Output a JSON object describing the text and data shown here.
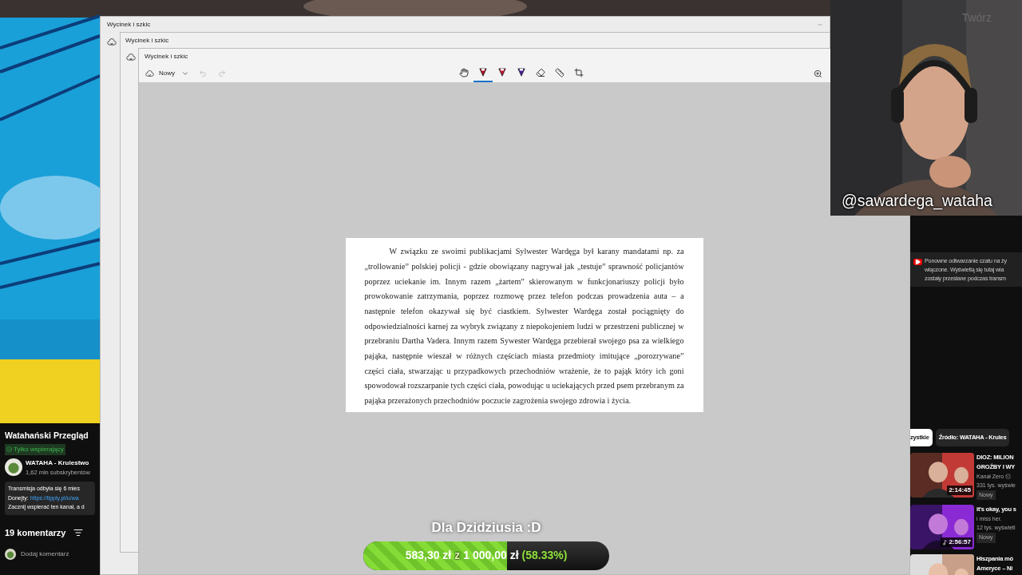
{
  "left_panel": {
    "title": "Watahański Przegląd",
    "badge": "Tylko wspierający",
    "channel": {
      "name": "WATAHA - Krulestwo",
      "subscribers": "1,62 mln subskrybentów"
    },
    "description": {
      "first_line": "Transmisja odbyła się 6 mies",
      "donations_label": "Donejty:",
      "donations_link": "https://tipply.pl/u/wa",
      "last_line": "Zacznij wspierać ten kanał, a d"
    },
    "comments": {
      "count": "19 komentarzy",
      "placeholder": "Dodaj komentarz"
    }
  },
  "windows": [
    {
      "title": "Wycinek i szkic"
    },
    {
      "title": "Wycinek i szkic"
    }
  ],
  "editor": {
    "title": "Wycinek i szkic",
    "new_label": "Nowy",
    "tools": [
      {
        "kind": "touch",
        "selected": false
      },
      {
        "kind": "pen",
        "color": "#b0102a",
        "selected": true
      },
      {
        "kind": "pen",
        "color": "#c4142c",
        "selected": false
      },
      {
        "kind": "pen",
        "color": "#4a1c9c",
        "selected": false
      },
      {
        "kind": "eraser",
        "selected": false
      },
      {
        "kind": "ruler",
        "selected": false
      },
      {
        "kind": "crop",
        "selected": false
      }
    ],
    "document": {
      "paragraph": "W związku ze swoimi publikacjami Sylwester Wardęga był karany mandatami np. za „trollowanie” polskiej policji - gdzie obowiązany nagrywał jak „testuje” sprawność policjantów poprzez uciekanie im. Innym razem „żartem” skierowanym w funkcjonariuszy policji było prowokowanie zatrzymania, poprzez rozmowę przez telefon podczas prowadzenia auta – a następnie telefon okazywał się być ciastkiem. Sylwester Wardęga został pociągnięty do odpowiedzialności karnej za wybryk związany z niepokojeniem ludzi w przestrzeni publicznej w przebraniu Dartha Vadera. Innym razem Sywester Wardęga przebierał swojego psa za wielkiego pająka, następnie wieszał w różnych częściach miasta przedmioty imitujące „porozrywane” części ciała, stwarzając u przypadkowych przechodniów wrażenie, że to pająk który ich goni spowodował rozszarpanie tych części ciała, powodując u uciekających przed psem przebranym za pająka przerażonych przechodniów poczucie zagrożenia swojego zdrowia i życia."
    }
  },
  "webcam": {
    "overlay_text": "Twórz",
    "handle": "@sawardega_wataha"
  },
  "chat_notice": [
    "Ponowne odtwarzanie czatu na ży",
    "włączone. Wyświetlą się tutaj wia",
    "zostały przesłane podczas transm"
  ],
  "chips": [
    {
      "label": "zystkie",
      "selected": true
    },
    {
      "label": "Źródło: WATAHA - Krules",
      "selected": false
    }
  ],
  "videos": [
    {
      "title_lines": [
        "DIOZ: MILION",
        "GROŹBY I WY"
      ],
      "channel": "Kanał Zero",
      "verified": true,
      "views": "331 tys. wyświe",
      "badge": "Nowy",
      "duration": "2:14:45",
      "music": false
    },
    {
      "title_lines": [
        "it's okay, you s"
      ],
      "channel": "i miss her.",
      "verified": false,
      "views": "12 tys. wyświetl",
      "badge": "Nowy",
      "duration": "2:56:57",
      "music": true
    },
    {
      "title_lines": [
        "Hiszpania mó",
        "Ameryce – Ni"
      ]
    }
  ],
  "donation": {
    "title": "Dla Dzidziusia :D",
    "raised": "583,30 zł",
    "separator": "z",
    "goal": "1 000,00 zł",
    "percent": "(58.33%)",
    "level": 0.5833
  }
}
